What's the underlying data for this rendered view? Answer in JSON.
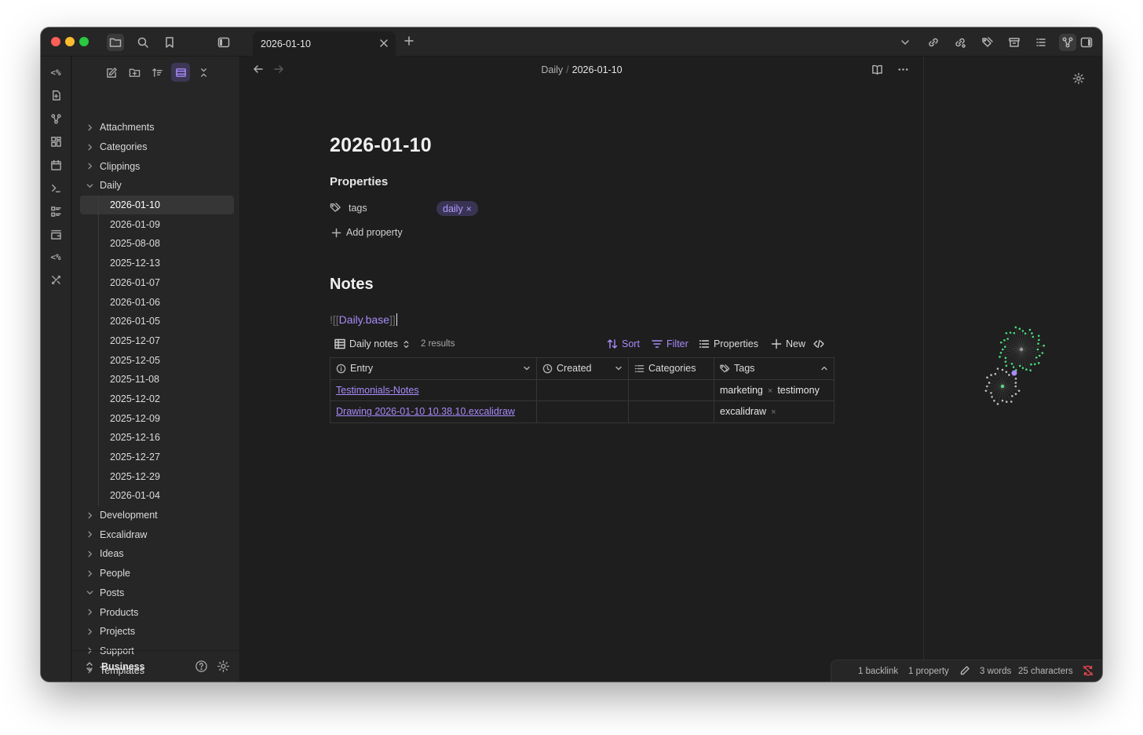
{
  "tab": {
    "title": "2026-01-10"
  },
  "breadcrumb": {
    "folder": "Daily",
    "separator": "/",
    "note": "2026-01-10"
  },
  "ribbon": {
    "top_glyph": "<%",
    "templater_glyph": "<%"
  },
  "sidebar": {
    "tree": [
      {
        "label": "Attachments",
        "type": "folder",
        "expanded": false
      },
      {
        "label": "Categories",
        "type": "folder",
        "expanded": false
      },
      {
        "label": "Clippings",
        "type": "folder",
        "expanded": false
      },
      {
        "label": "Daily",
        "type": "folder",
        "expanded": true
      },
      {
        "label": "2026-01-10",
        "type": "file",
        "selected": true
      },
      {
        "label": "2026-01-09",
        "type": "file"
      },
      {
        "label": "2025-08-08",
        "type": "file"
      },
      {
        "label": "2025-12-13",
        "type": "file"
      },
      {
        "label": "2026-01-07",
        "type": "file"
      },
      {
        "label": "2026-01-06",
        "type": "file"
      },
      {
        "label": "2026-01-05",
        "type": "file"
      },
      {
        "label": "2025-12-07",
        "type": "file"
      },
      {
        "label": "2025-12-05",
        "type": "file"
      },
      {
        "label": "2025-11-08",
        "type": "file"
      },
      {
        "label": "2025-12-02",
        "type": "file"
      },
      {
        "label": "2025-12-09",
        "type": "file"
      },
      {
        "label": "2025-12-16",
        "type": "file"
      },
      {
        "label": "2025-12-27",
        "type": "file"
      },
      {
        "label": "2025-12-29",
        "type": "file"
      },
      {
        "label": "2026-01-04",
        "type": "file"
      },
      {
        "label": "Development",
        "type": "folder",
        "expanded": false
      },
      {
        "label": "Excalidraw",
        "type": "folder",
        "expanded": false
      },
      {
        "label": "Ideas",
        "type": "folder",
        "expanded": false
      },
      {
        "label": "People",
        "type": "folder",
        "expanded": false
      },
      {
        "label": "Posts",
        "type": "folder",
        "expanded": true
      },
      {
        "label": "Products",
        "type": "folder",
        "expanded": false
      },
      {
        "label": "Projects",
        "type": "folder",
        "expanded": false
      },
      {
        "label": "Support",
        "type": "folder",
        "expanded": false
      },
      {
        "label": "Templates",
        "type": "folder",
        "expanded": false
      }
    ],
    "vault_name": "Business"
  },
  "note": {
    "title": "2026-01-10",
    "properties_heading": "Properties",
    "property": {
      "key": "tags",
      "value": "daily",
      "remove_glyph": "×"
    },
    "add_property": "Add property",
    "notes_heading": "Notes",
    "embed": {
      "open": "![[",
      "link": "Daily.base",
      "close": "]]"
    }
  },
  "base": {
    "view_name": "Daily notes",
    "results": "2 results",
    "sort": "Sort",
    "filter": "Filter",
    "properties": "Properties",
    "new": "New",
    "columns": [
      "Entry",
      "Created",
      "Categories",
      "Tags"
    ],
    "rows": [
      {
        "entry": "Testimonials-Notes",
        "created": "",
        "categories": "",
        "tags": [
          "marketing",
          "testimony"
        ]
      },
      {
        "entry": "Drawing 2026-01-10 10.38.10.excalidraw",
        "created": "",
        "categories": "",
        "tags": [
          "excalidraw"
        ]
      }
    ]
  },
  "status": {
    "backlinks": "1 backlink",
    "properties": "1 property",
    "words": "3 words",
    "characters": "25 characters"
  },
  "colors": {
    "accent": "#a78bfa",
    "graph_cluster_1": "#4ade80",
    "graph_cluster_2": "#bdbdbd",
    "graph_node": "#a78bfa",
    "sync_error": "#e5484d"
  }
}
